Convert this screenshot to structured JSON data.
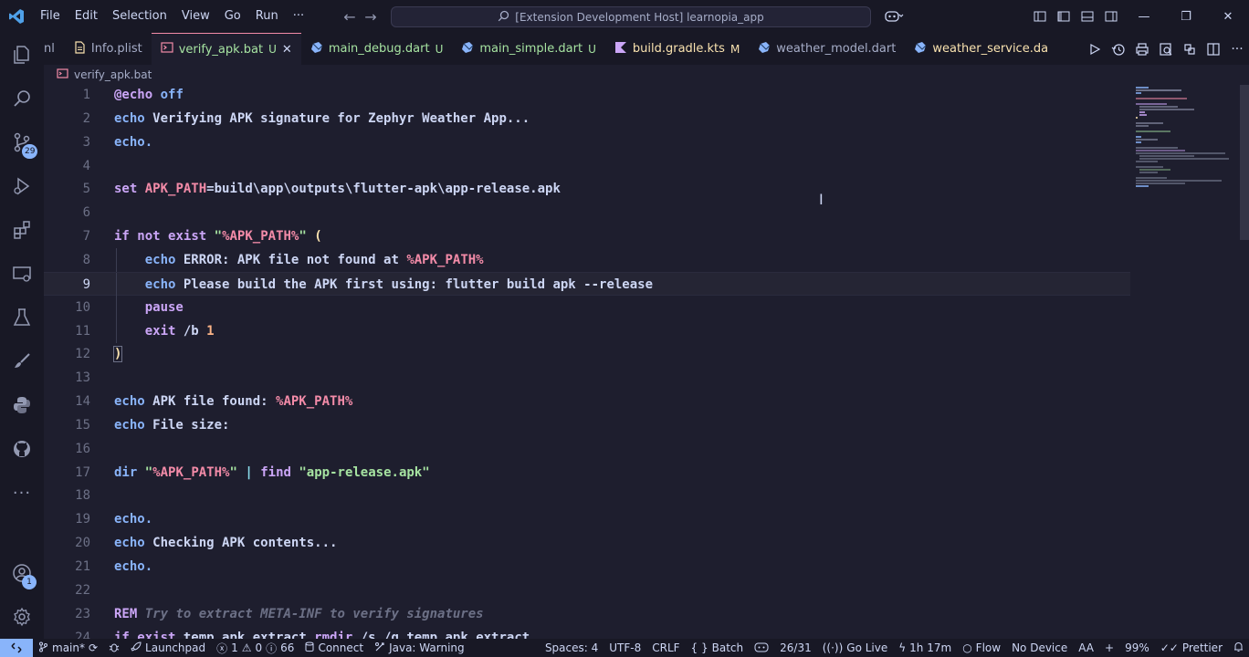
{
  "titlebar": {
    "menu": [
      "File",
      "Edit",
      "Selection",
      "View",
      "Go",
      "Run",
      "···"
    ],
    "command_center": "[Extension Development Host] learnopia_app"
  },
  "activitybar": {
    "items": [
      "explorer",
      "search",
      "source-control",
      "run-debug",
      "extensions",
      "remote-explorer",
      "testing",
      "paint",
      "python",
      "github",
      "more"
    ],
    "source_control_badge": "29",
    "accounts_badge": "1"
  },
  "tabs": [
    {
      "label": "nl",
      "status": "",
      "icon": "file-icon",
      "color": "#a6adc8"
    },
    {
      "label": "Info.plist",
      "status": "",
      "icon": "plist-icon",
      "color": "#a6adc8"
    },
    {
      "label": "verify_apk.bat",
      "status": "U",
      "icon": "bat-icon",
      "color": "#a6e3a1",
      "active": true
    },
    {
      "label": "main_debug.dart",
      "status": "U",
      "icon": "dart-icon",
      "color": "#a6e3a1"
    },
    {
      "label": "main_simple.dart",
      "status": "U",
      "icon": "dart-icon",
      "color": "#a6e3a1"
    },
    {
      "label": "build.gradle.kts",
      "status": "M",
      "icon": "kotlin-icon",
      "color": "#f9e2af"
    },
    {
      "label": "weather_model.dart",
      "status": "",
      "icon": "dart-icon",
      "color": "#a6adc8"
    },
    {
      "label": "weather_service.da",
      "status": "",
      "icon": "dart-icon",
      "color": "#f9e2af"
    }
  ],
  "breadcrumb": {
    "file": "verify_apk.bat"
  },
  "editor": {
    "lines": [
      {
        "n": "1",
        "tokens": [
          [
            "kw",
            "@echo"
          ],
          [
            "plain",
            " "
          ],
          [
            "cmd",
            "off"
          ]
        ]
      },
      {
        "n": "2",
        "tokens": [
          [
            "cmd",
            "echo"
          ],
          [
            "plain",
            " Verifying APK signature for Zephyr Weather App..."
          ]
        ]
      },
      {
        "n": "3",
        "tokens": [
          [
            "cmd",
            "echo."
          ]
        ]
      },
      {
        "n": "4",
        "tokens": []
      },
      {
        "n": "5",
        "tokens": [
          [
            "kw",
            "set"
          ],
          [
            "plain",
            " "
          ],
          [
            "var",
            "APK_PATH"
          ],
          [
            "plain",
            "=build\\app\\outputs\\flutter-apk\\app-release.apk"
          ]
        ]
      },
      {
        "n": "6",
        "tokens": []
      },
      {
        "n": "7",
        "tokens": [
          [
            "kw",
            "if"
          ],
          [
            "plain",
            " "
          ],
          [
            "kw",
            "not"
          ],
          [
            "plain",
            " "
          ],
          [
            "kw",
            "exist"
          ],
          [
            "plain",
            " "
          ],
          [
            "str",
            "\""
          ],
          [
            "var",
            "%APK_PATH%"
          ],
          [
            "str",
            "\""
          ],
          [
            "plain",
            " "
          ],
          [
            "paren",
            "("
          ]
        ]
      },
      {
        "n": "8",
        "tokens": [
          [
            "plain",
            "    "
          ],
          [
            "cmd",
            "echo"
          ],
          [
            "plain",
            " ERROR: APK file not found at "
          ],
          [
            "var",
            "%APK_PATH%"
          ]
        ],
        "guide": true
      },
      {
        "n": "9",
        "tokens": [
          [
            "plain",
            "    "
          ],
          [
            "cmd",
            "echo"
          ],
          [
            "plain",
            " Please build the APK first using: flutter build apk --release"
          ]
        ],
        "guide": true,
        "current": true
      },
      {
        "n": "10",
        "tokens": [
          [
            "plain",
            "    "
          ],
          [
            "kw",
            "pause"
          ]
        ],
        "guide": true
      },
      {
        "n": "11",
        "tokens": [
          [
            "plain",
            "    "
          ],
          [
            "kw",
            "exit"
          ],
          [
            "plain",
            " /b "
          ],
          [
            "num",
            "1"
          ]
        ],
        "guide": true
      },
      {
        "n": "12",
        "tokens": [
          [
            "paren-hl",
            ")"
          ]
        ]
      },
      {
        "n": "13",
        "tokens": []
      },
      {
        "n": "14",
        "tokens": [
          [
            "cmd",
            "echo"
          ],
          [
            "plain",
            " APK file found: "
          ],
          [
            "var",
            "%APK_PATH%"
          ]
        ]
      },
      {
        "n": "15",
        "tokens": [
          [
            "cmd",
            "echo"
          ],
          [
            "plain",
            " File size:"
          ]
        ]
      },
      {
        "n": "16",
        "tokens": []
      },
      {
        "n": "17",
        "tokens": [
          [
            "cmd",
            "dir"
          ],
          [
            "plain",
            " "
          ],
          [
            "str",
            "\""
          ],
          [
            "var",
            "%APK_PATH%"
          ],
          [
            "str",
            "\""
          ],
          [
            "plain",
            " "
          ],
          [
            "pipe",
            "|"
          ],
          [
            "plain",
            " "
          ],
          [
            "kw",
            "find"
          ],
          [
            "plain",
            " "
          ],
          [
            "str",
            "\"app-release.apk\""
          ]
        ]
      },
      {
        "n": "18",
        "tokens": []
      },
      {
        "n": "19",
        "tokens": [
          [
            "cmd",
            "echo."
          ]
        ]
      },
      {
        "n": "20",
        "tokens": [
          [
            "cmd",
            "echo"
          ],
          [
            "plain",
            " Checking APK contents..."
          ]
        ]
      },
      {
        "n": "21",
        "tokens": [
          [
            "cmd",
            "echo."
          ]
        ]
      },
      {
        "n": "22",
        "tokens": []
      },
      {
        "n": "23",
        "tokens": [
          [
            "kw",
            "REM"
          ],
          [
            "cmt",
            " Try to extract META-INF to verify signatures"
          ]
        ]
      },
      {
        "n": "24",
        "tokens": [
          [
            "kw",
            "if"
          ],
          [
            "plain",
            " "
          ],
          [
            "kw",
            "exist"
          ],
          [
            "plain",
            " temp_apk_extract "
          ],
          [
            "kw",
            "rmdir"
          ],
          [
            "plain",
            " /s /q temp_apk_extract"
          ]
        ]
      }
    ]
  },
  "statusbar": {
    "branch": "main*",
    "launchpad": "Launchpad",
    "errors": "1",
    "warnings": "0",
    "infos": "66",
    "connect": "Connect",
    "java": "Java: Warning",
    "spaces": "Spaces: 4",
    "encoding": "UTF-8",
    "eol": "CRLF",
    "language": "Batch",
    "position": "26/31",
    "go_live": "Go Live",
    "time": "1h 17m",
    "flow": "Flow",
    "device": "No Device",
    "aa": "AA",
    "plus": "+",
    "zoom": "99%",
    "prettier": "Prettier"
  }
}
